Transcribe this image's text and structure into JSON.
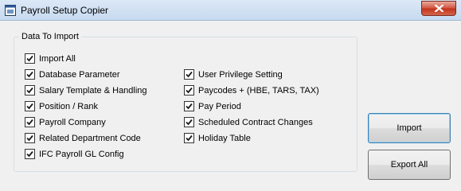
{
  "window": {
    "title": "Payroll Setup Copier"
  },
  "group": {
    "label": "Data To Import"
  },
  "checkboxes": {
    "left": [
      {
        "label": "Import All",
        "checked": true
      },
      {
        "label": "Database Parameter",
        "checked": true
      },
      {
        "label": "Salary Template & Handling",
        "checked": true
      },
      {
        "label": "Position / Rank",
        "checked": true
      },
      {
        "label": "Payroll Company",
        "checked": true
      },
      {
        "label": "Related Department Code",
        "checked": true
      },
      {
        "label": "IFC Payroll GL Config",
        "checked": true
      }
    ],
    "right": [
      {
        "label": "User Privilege Setting",
        "checked": true
      },
      {
        "label": "Paycodes + (HBE, TARS, TAX)",
        "checked": true
      },
      {
        "label": "Pay Period",
        "checked": true
      },
      {
        "label": "Scheduled Contract Changes",
        "checked": true
      },
      {
        "label": "Holiday Table",
        "checked": true
      }
    ]
  },
  "buttons": {
    "import_label": "Import",
    "export_label": "Export All"
  },
  "icons": {
    "app": "app-window-icon",
    "close": "close-icon",
    "check": "checkmark-icon"
  },
  "colors": {
    "close_button": "#c1321b",
    "title_bar": "#c7daf0",
    "default_button_border": "#3c7fb1"
  }
}
